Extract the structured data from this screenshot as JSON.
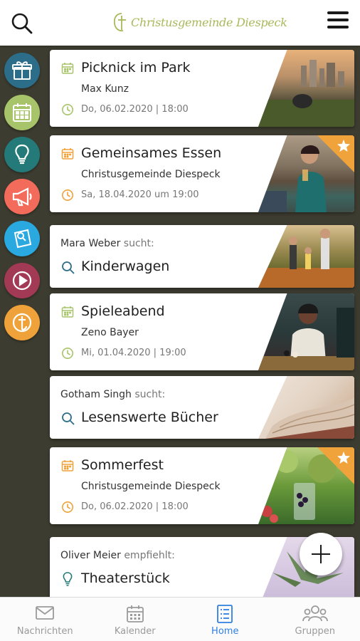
{
  "header": {
    "logo_text": "Christusgemeinde Diespeck"
  },
  "rail": [
    {
      "name": "gift",
      "color": "#2c6e8a"
    },
    {
      "name": "calendar",
      "color": "#a8c46a"
    },
    {
      "name": "lightbulb",
      "color": "#237a78"
    },
    {
      "name": "megaphone",
      "color": "#f26b5b"
    },
    {
      "name": "search-note",
      "color": "#2aa8e0"
    },
    {
      "name": "play",
      "color": "#a33a55"
    },
    {
      "name": "church-logo",
      "color": "#f0a23a"
    }
  ],
  "cards": [
    {
      "type": "event",
      "title": "Picknick im Park",
      "organizer": "Max Kunz",
      "date": "Do, 06.02.2020 | 18:00",
      "icon_color": "#a8c46a",
      "starred": false
    },
    {
      "type": "event",
      "title": "Gemeinsames Essen",
      "organizer": "Christusgemeinde Diespeck",
      "date": "Sa, 18.04.2020 um 19:00",
      "icon_color": "#f0a23a",
      "starred": true
    },
    {
      "type": "search",
      "person": "Mara Weber",
      "verb": "sucht:",
      "item": "Kinderwagen"
    },
    {
      "type": "event",
      "title": "Spieleabend",
      "organizer": "Zeno Bayer",
      "date": "Mi, 01.04.2020 | 19:00",
      "icon_color": "#a8c46a",
      "starred": false
    },
    {
      "type": "search",
      "person": "Gotham Singh",
      "verb": "sucht:",
      "item": "Lesenswerte Bücher"
    },
    {
      "type": "event",
      "title": "Sommerfest",
      "organizer": "Christusgemeinde Diespeck",
      "date": "Do, 06.02.2020 | 18:00",
      "icon_color": "#f0a23a",
      "starred": true
    },
    {
      "type": "recommend",
      "person": "Oliver Meier",
      "verb": "empfiehlt:",
      "item": "Theaterstück"
    }
  ],
  "bottom_nav": [
    {
      "label": "Nachrichten",
      "active": false
    },
    {
      "label": "Kalender",
      "active": false
    },
    {
      "label": "Home",
      "active": true
    },
    {
      "label": "Gruppen",
      "active": false
    }
  ],
  "colors": {
    "accent": "#2f7fe0",
    "background": "#3d3c30",
    "green": "#a8c46a",
    "orange": "#f0a23a"
  }
}
